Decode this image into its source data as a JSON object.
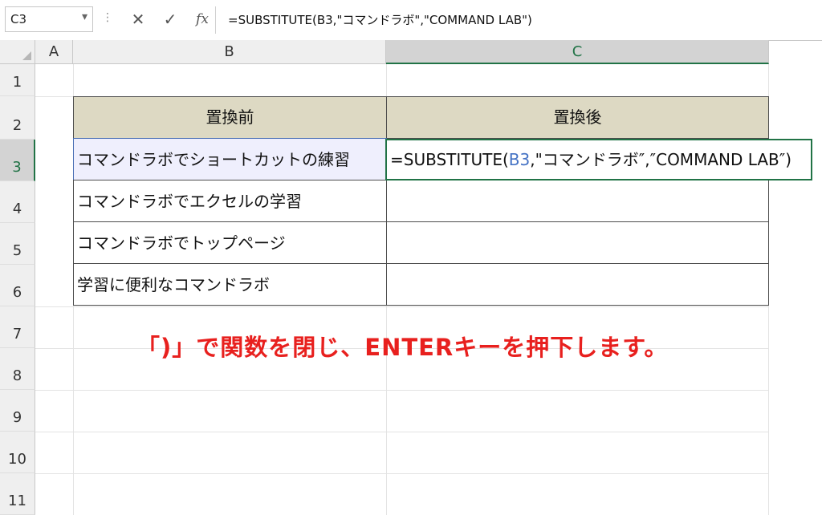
{
  "formula_bar": {
    "name_box": "C3",
    "fx_label": "fx",
    "formula": "=SUBSTITUTE(B3,\"コマンドラボ\",\"COMMAND LAB\")"
  },
  "columns": [
    "A",
    "B",
    "C"
  ],
  "rows": [
    "1",
    "2",
    "3",
    "4",
    "5",
    "6",
    "7",
    "8",
    "9",
    "10",
    "11"
  ],
  "table": {
    "header_before": "置換前",
    "header_after": "置換後",
    "rows": [
      "コマンドラボでショートカットの練習",
      "コマンドラボでエクセルの学習",
      "コマンドラボでトップページ",
      "学習に便利なコマンドラボ"
    ],
    "header_fill": "#ddd9c3"
  },
  "editing_cell": {
    "prefix": "=SUBSTITUTE(",
    "ref": "B3",
    "suffix": ",\"コマンドラボ″,″COMMAND LAB″)"
  },
  "annotation": "「)」で関数を閉じ、ENTERキーを押下します。",
  "colors": {
    "annotation": "#e8201e",
    "selection": "#217346",
    "reference": "#4472c4"
  }
}
